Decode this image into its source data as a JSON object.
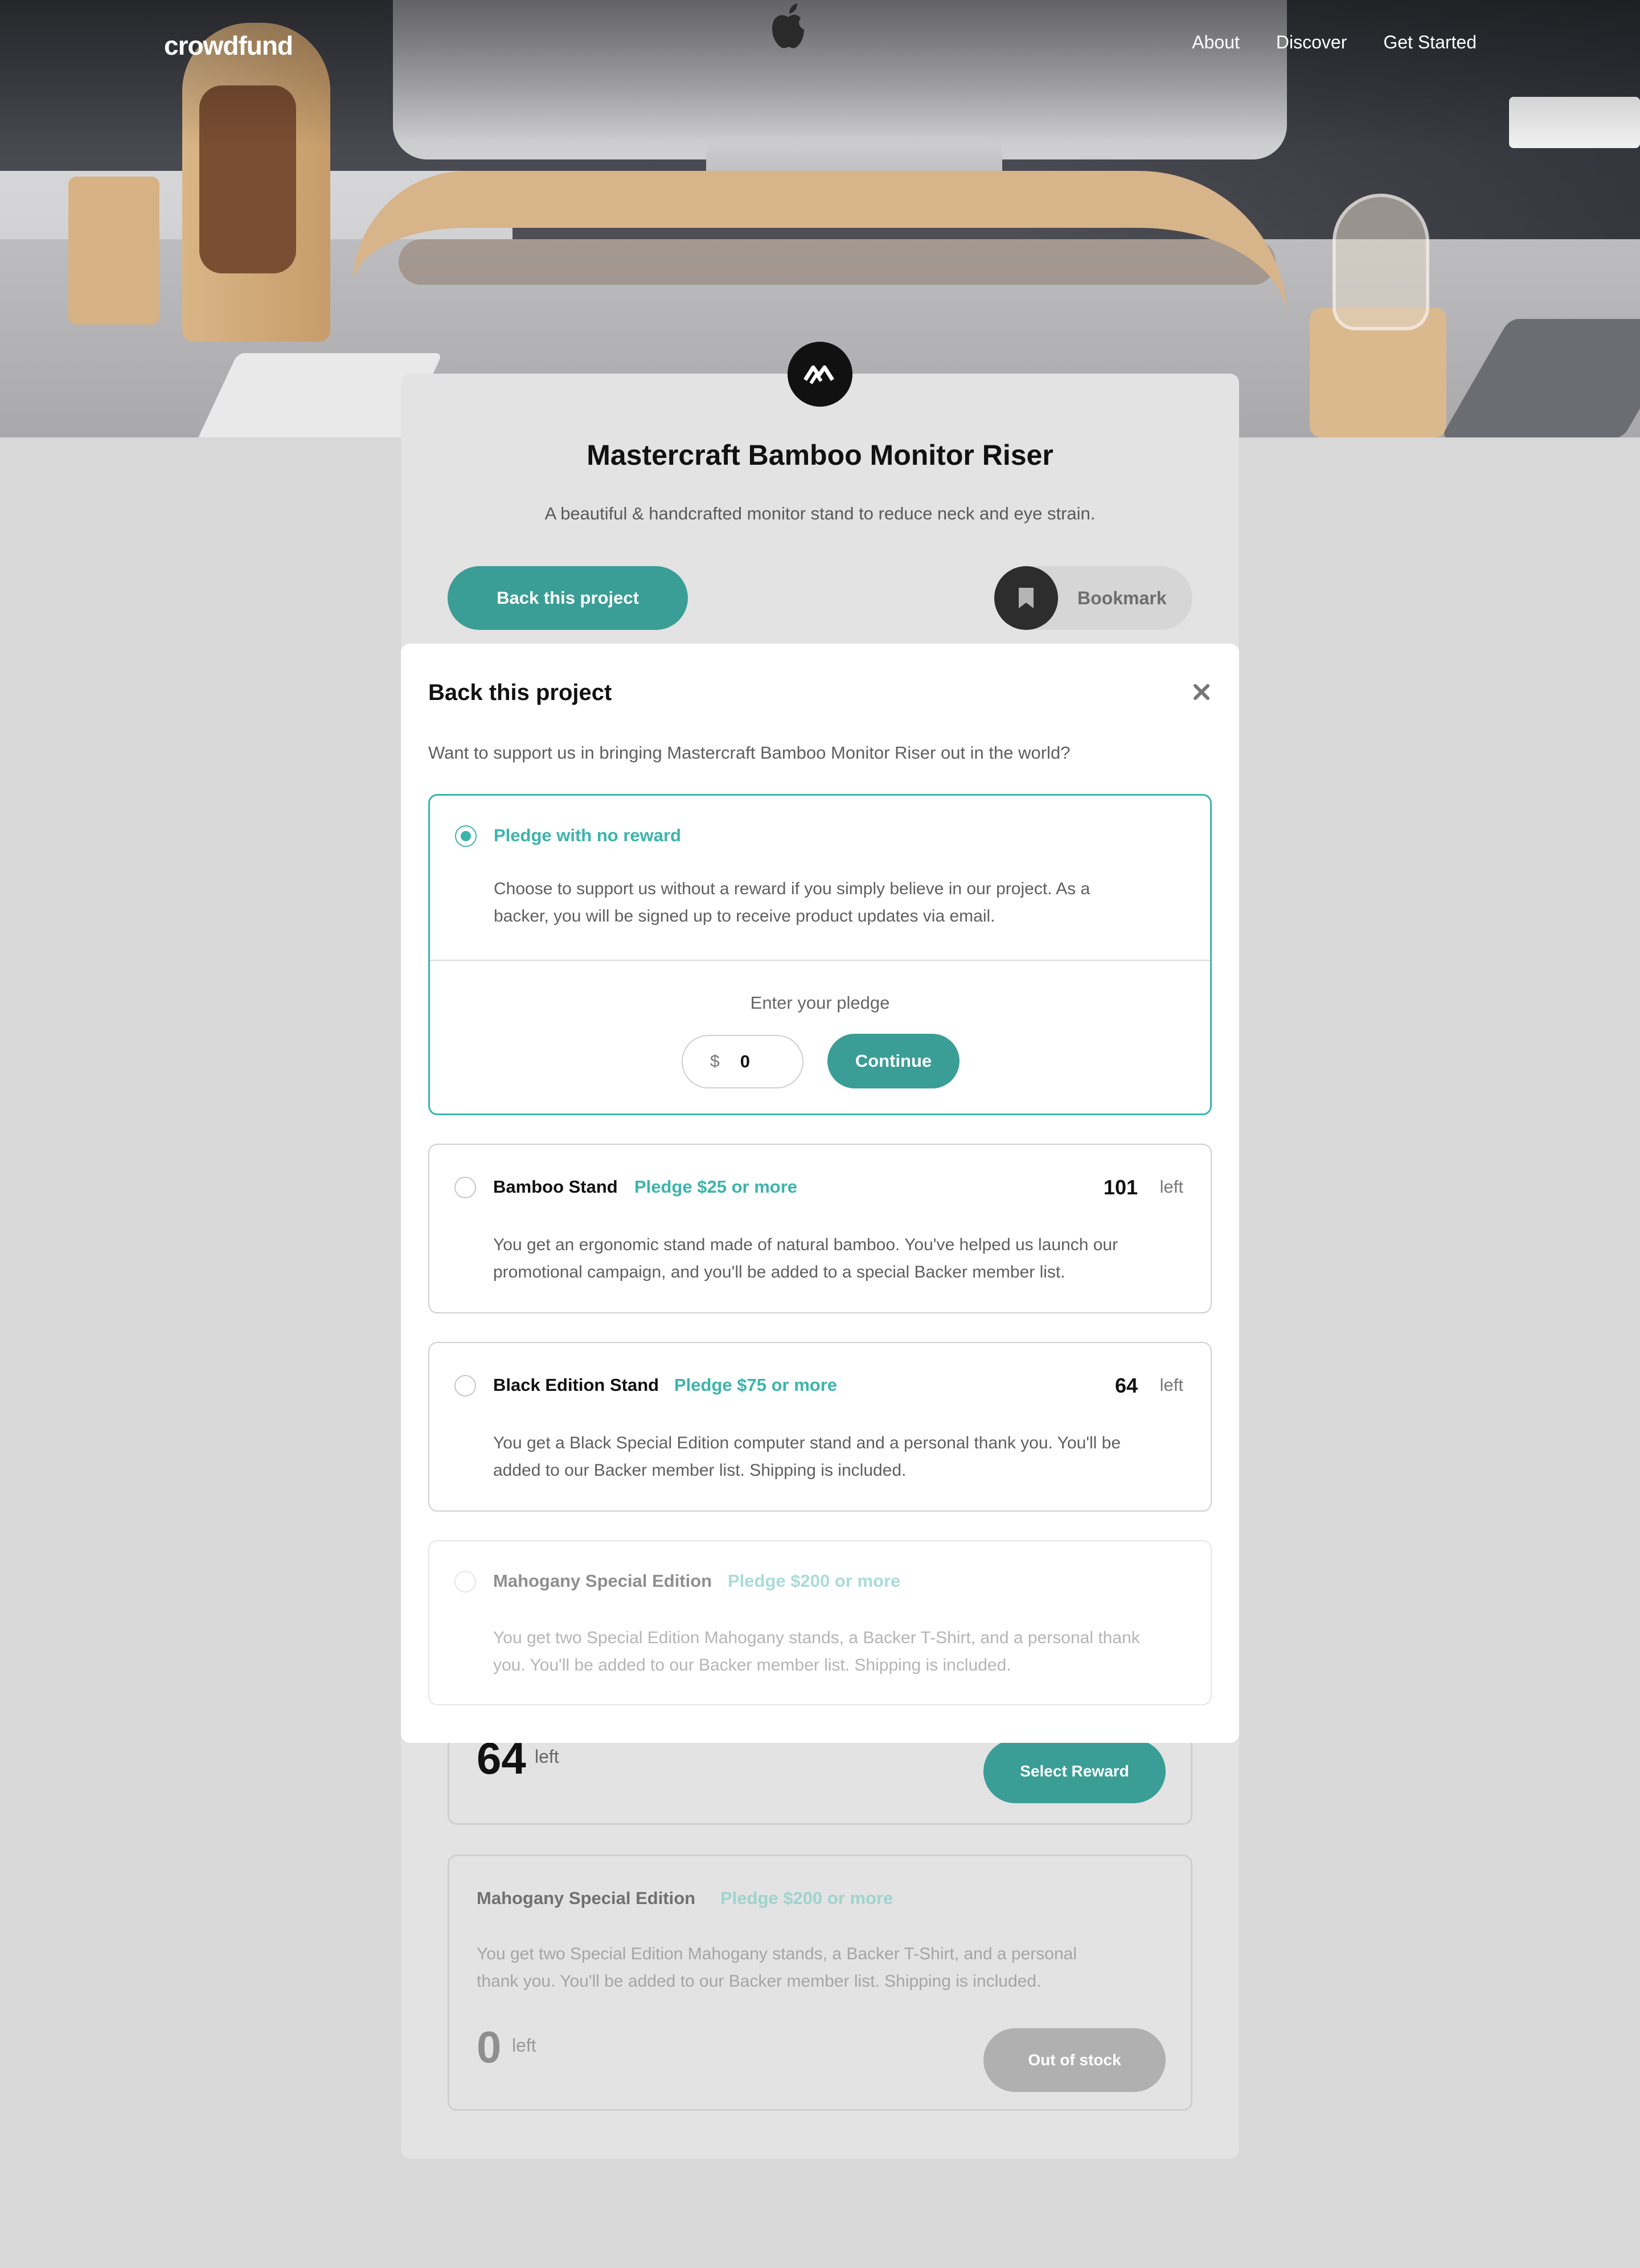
{
  "header": {
    "logo": "crowdfund",
    "nav": [
      "About",
      "Discover",
      "Get Started"
    ]
  },
  "project": {
    "title": "Mastercraft Bamboo Monitor Riser",
    "description": "A beautiful & handcrafted monitor stand to reduce neck and eye strain.",
    "back_label": "Back this project",
    "bookmark_label": "Bookmark"
  },
  "background_rewards": [
    {
      "count": "64",
      "left_label": "left",
      "button": "Select Reward"
    },
    {
      "name": "Mahogany Special Edition",
      "pledge": "Pledge $200 or more",
      "description_lines": [
        "You get two Special Edition Mahogany stands, a Backer T-Shirt, and a personal",
        "thank you. You'll be added to our Backer member list. Shipping is included."
      ],
      "count": "0",
      "left_label": "left",
      "button": "Out of stock"
    }
  ],
  "modal": {
    "title": "Back this project",
    "intro": "Want to support us in bringing Mastercraft Bamboo Monitor Riser out in the world?",
    "options": [
      {
        "name": "Pledge with no reward",
        "description_lines": [
          "Choose to support us without a reward if you simply believe in our project. As a",
          "backer, you will be signed up to receive product updates via email."
        ],
        "selected": true,
        "enter_pledge_label": "Enter your pledge",
        "currency": "$",
        "amount": "0",
        "continue_label": "Continue"
      },
      {
        "name": "Bamboo Stand",
        "pledge": "Pledge $25 or more",
        "count": "101",
        "left_label": "left",
        "description_lines": [
          "You get an ergonomic stand made of natural bamboo. You've helped us launch our",
          "promotional campaign, and you'll be added to a special Backer member list."
        ]
      },
      {
        "name": "Black Edition Stand",
        "pledge": "Pledge $75 or more",
        "count": "64",
        "left_label": "left",
        "description_lines": [
          "You get a Black Special Edition computer stand and a personal thank you. You'll be",
          "added to our Backer member list. Shipping is included."
        ]
      },
      {
        "name": "Mahogany Special Edition",
        "pledge": "Pledge $200 or more",
        "disabled": true,
        "description_lines": [
          "You get two Special Edition Mahogany stands, a Backer T-Shirt, and a personal thank",
          "you. You'll be added to our Backer member list. Shipping is included."
        ]
      }
    ]
  },
  "icons": {
    "close": "close-icon",
    "bookmark": "bookmark-icon",
    "brand": "mastercraft-logo-icon"
  },
  "colors": {
    "accent": "#3cb4ac",
    "accent_dark": "#3a9e96",
    "text_muted": "#5f5f5f",
    "page_bg": "#d8d8d8"
  }
}
